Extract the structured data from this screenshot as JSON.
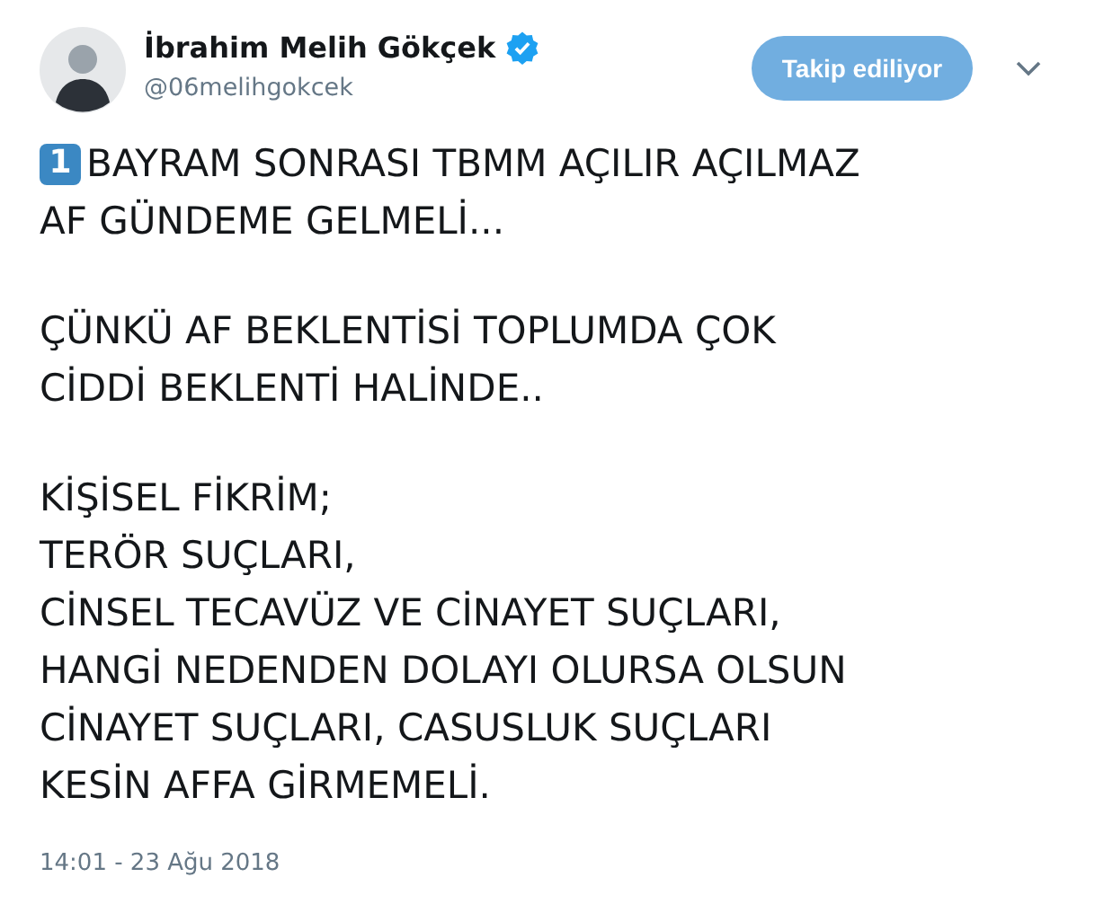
{
  "author": {
    "name": "İbrahim Melih Gökçek",
    "handle": "@06melihgokcek",
    "verified": true
  },
  "follow_button": {
    "label": "Takip ediliyor",
    "following": true
  },
  "tweet": {
    "badge": "1",
    "paragraphs": [
      [
        "BAYRAM SONRASI TBMM AÇILIR AÇILMAZ",
        "AF GÜNDEME GELMELİ..."
      ],
      [
        "ÇÜNKÜ AF BEKLENTİSİ TOPLUMDA ÇOK",
        "CİDDİ BEKLENTİ HALİNDE.."
      ],
      [
        "KİŞİSEL FİKRİM;",
        "TERÖR SUÇLARI,",
        "CİNSEL TECAVÜZ VE CİNAYET SUÇLARI,",
        "HANGİ NEDENDEN DOLAYI OLURSA OLSUN",
        "CİNAYET SUÇLARI, CASUSLUK SUÇLARI",
        "KESİN AFFA GİRMEMELİ."
      ]
    ]
  },
  "timestamp": "14:01 - 23 Ağu 2018"
}
